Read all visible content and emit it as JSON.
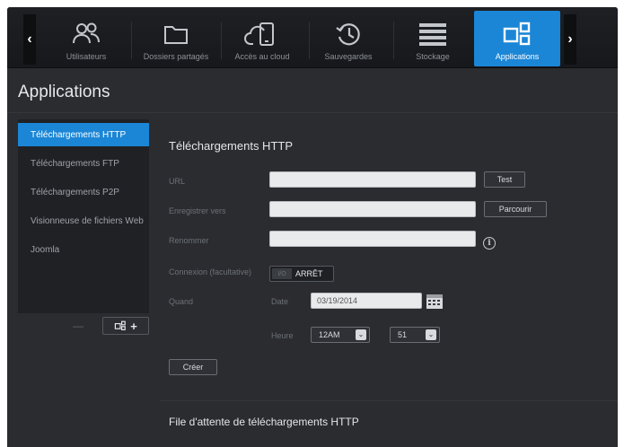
{
  "nav": {
    "items": [
      {
        "label": "Utilisateurs",
        "icon": "users-icon"
      },
      {
        "label": "Dossiers partagés",
        "icon": "folder-icon"
      },
      {
        "label": "Accès au cloud",
        "icon": "cloud-device-icon"
      },
      {
        "label": "Sauvegardes",
        "icon": "backup-clock-icon"
      },
      {
        "label": "Stockage",
        "icon": "storage-stack-icon"
      },
      {
        "label": "Applications",
        "icon": "apps-icon"
      }
    ],
    "prev_arrow": "‹",
    "next_arrow": "›",
    "active": "Applications",
    "accent_color": "#1b86d6"
  },
  "page": {
    "title": "Applications"
  },
  "sidebar": {
    "items": [
      {
        "label": "Téléchargements HTTP"
      },
      {
        "label": "Téléchargements FTP"
      },
      {
        "label": "Téléchargements P2P"
      },
      {
        "label": "Visionneuse de fichiers Web"
      },
      {
        "label": "Joomla"
      }
    ],
    "active_index": 0,
    "remove_label": "—",
    "add_label": "+"
  },
  "form": {
    "section_title": "Téléchargements HTTP",
    "url_label": "URL",
    "url_value": "",
    "test_button": "Test",
    "save_to_label": "Enregistrer vers",
    "save_to_value": "",
    "browse_button": "Parcourir",
    "rename_label": "Renommer",
    "rename_value": "",
    "info_glyph": "i",
    "auth_label": "Connexion (facultative)",
    "toggle_off_text": "I/O",
    "toggle_state": "ARRÊT",
    "when_label": "Quand",
    "date_label": "Date",
    "date_value": "03/19/2014",
    "time_label": "Heure",
    "hour_value": "12AM",
    "minute_value": "51",
    "create_button": "Créer"
  },
  "queue": {
    "title": "File d'attente de téléchargements HTTP"
  }
}
